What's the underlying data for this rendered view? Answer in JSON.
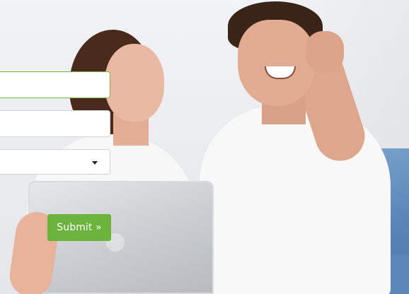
{
  "form": {
    "name_field": {
      "value": "",
      "placeholder": ""
    },
    "email_field": {
      "value": "",
      "placeholder": ""
    },
    "select_field": {
      "selected": ""
    },
    "submit_label": "Submit »"
  },
  "colors": {
    "accent": "#6cb33e",
    "focus_border": "#7ab348"
  },
  "icons": {
    "select_caret": "chevron-down-icon"
  }
}
